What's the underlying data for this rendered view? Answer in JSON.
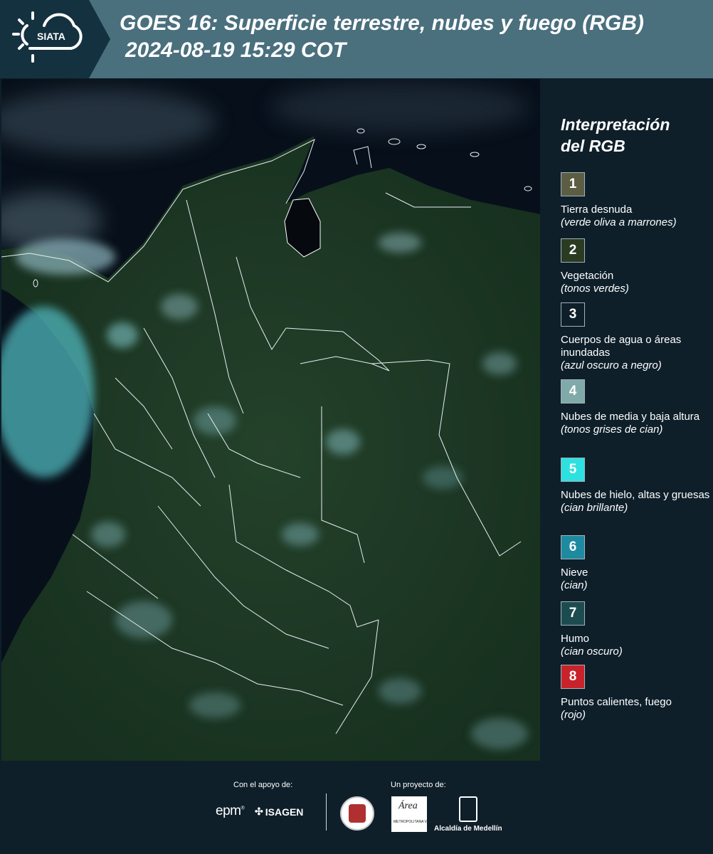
{
  "header": {
    "logo_text": "SIATA",
    "title_line1": "GOES 16: Superficie terrestre, nubes y fuego (RGB)",
    "title_line2": "2024-08-19 15:29 COT"
  },
  "legend": {
    "title_line1": "Interpretación",
    "title_line2": "del RGB",
    "items": [
      {
        "number": "1",
        "color": "#5d5d43",
        "label": "Tierra desnuda",
        "desc": "(verde oliva a marrones)"
      },
      {
        "number": "2",
        "color": "#2a3b22",
        "label": "Vegetación",
        "desc": "(tonos verdes)"
      },
      {
        "number": "3",
        "color": "#0e1f2a",
        "label": "Cuerpos de agua o áreas inundadas",
        "desc": "(azul oscuro a negro)"
      },
      {
        "number": "4",
        "color": "#7faaa9",
        "label": "Nubes de media y baja altura",
        "desc": "(tonos grises de cian)"
      },
      {
        "number": "5",
        "color": "#2ee0e0",
        "label": "Nubes de hielo, altas y gruesas",
        "desc": "(cian brillante)"
      },
      {
        "number": "6",
        "color": "#1e8aa0",
        "label": "Nieve",
        "desc": "(cian)"
      },
      {
        "number": "7",
        "color": "#1c4c50",
        "label": "Humo",
        "desc": "(cian oscuro)"
      },
      {
        "number": "8",
        "color": "#c8232a",
        "label": "Puntos calientes, fuego",
        "desc": "(rojo)"
      }
    ]
  },
  "footer": {
    "support_label": "Con el apoyo de:",
    "project_label": "Un proyecto de:",
    "epm_logo": "epm",
    "isagen_logo": "ISAGEN",
    "area_logo_title": "Área",
    "area_logo_text": "METROPOLITANA Valle de Aburrá",
    "alcaldia_label": "Alcaldía de Medellín"
  }
}
